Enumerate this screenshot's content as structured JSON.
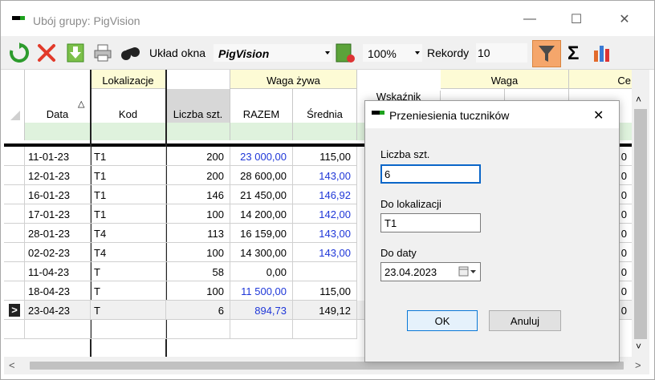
{
  "window": {
    "title": "Ubój grupy: PigVision",
    "minimize_glyph": "—",
    "maximize_glyph": "☐",
    "close_glyph": "✕"
  },
  "toolbar": {
    "icons": [
      "refresh-icon",
      "delete-icon",
      "download-icon",
      "print-icon",
      "binoculars-icon"
    ],
    "layout_label": "Układ okna",
    "layout_value": "PigVision",
    "zoom_value": "100%",
    "records_label": "Rekordy",
    "records_value": "10",
    "right_icons": [
      "filter-icon",
      "sum-icon",
      "chart-icon"
    ],
    "sum_glyph": "Σ"
  },
  "grid": {
    "group_headers": {
      "lokalizacje": "Lokalizacje",
      "waga_zywa": "Waga żywa",
      "wskaznik": "Wskaźnik",
      "waga": "Waga",
      "ce": "Ce"
    },
    "columns": {
      "data": "Data",
      "kod": "Kod",
      "liczba": "Liczba szt.",
      "razem": "RAZEM",
      "srednia": "Średnia"
    },
    "sort_glyph": "△",
    "current_row_glyph": ">",
    "rows": [
      {
        "data": "11-01-23",
        "kod": "T1",
        "liczba": "200",
        "razem": "23 000,00",
        "srednia": "115,00",
        "extra": "0"
      },
      {
        "data": "12-01-23",
        "kod": "T1",
        "liczba": "200",
        "razem": "28 600,00",
        "srednia": "143,00",
        "extra": "0"
      },
      {
        "data": "16-01-23",
        "kod": "T1",
        "liczba": "146",
        "razem": "21 450,00",
        "srednia": "146,92",
        "extra": "0"
      },
      {
        "data": "17-01-23",
        "kod": "T1",
        "liczba": "100",
        "razem": "14 200,00",
        "srednia": "142,00",
        "extra": "0"
      },
      {
        "data": "28-01-23",
        "kod": "T4",
        "liczba": "113",
        "razem": "16 159,00",
        "srednia": "143,00",
        "extra": "0"
      },
      {
        "data": "02-02-23",
        "kod": "T4",
        "liczba": "100",
        "razem": "14 300,00",
        "srednia": "143,00",
        "extra": "0"
      },
      {
        "data": "11-04-23",
        "kod": "T",
        "liczba": "58",
        "razem": "0,00",
        "srednia": "",
        "extra": "0"
      },
      {
        "data": "18-04-23",
        "kod": "T",
        "liczba": "100",
        "razem": "11 500,00",
        "srednia": "115,00",
        "extra": "0"
      },
      {
        "data": "23-04-23",
        "kod": "T",
        "liczba": "6",
        "razem": "894,73",
        "srednia": "149,12",
        "extra": "0"
      }
    ]
  },
  "dialog": {
    "title": "Przeniesienia tuczników",
    "close_glyph": "✕",
    "liczba_label": "Liczba szt.",
    "liczba_value": "6",
    "lokalizacja_label": "Do lokalizacji",
    "lokalizacja_value": "T1",
    "data_label": "Do daty",
    "data_value": "23.04.2023",
    "ok_label": "OK",
    "cancel_label": "Anuluj"
  },
  "scrollbars": {
    "up_glyph": "˄",
    "down_glyph": "˅",
    "left_glyph": "<",
    "right_glyph": ">"
  },
  "colors": {
    "accent_blue": "#1f37d8",
    "header_yellow": "#fdfbd5",
    "filter_green": "#dff2dd",
    "filter_button": "#f5a66b"
  }
}
